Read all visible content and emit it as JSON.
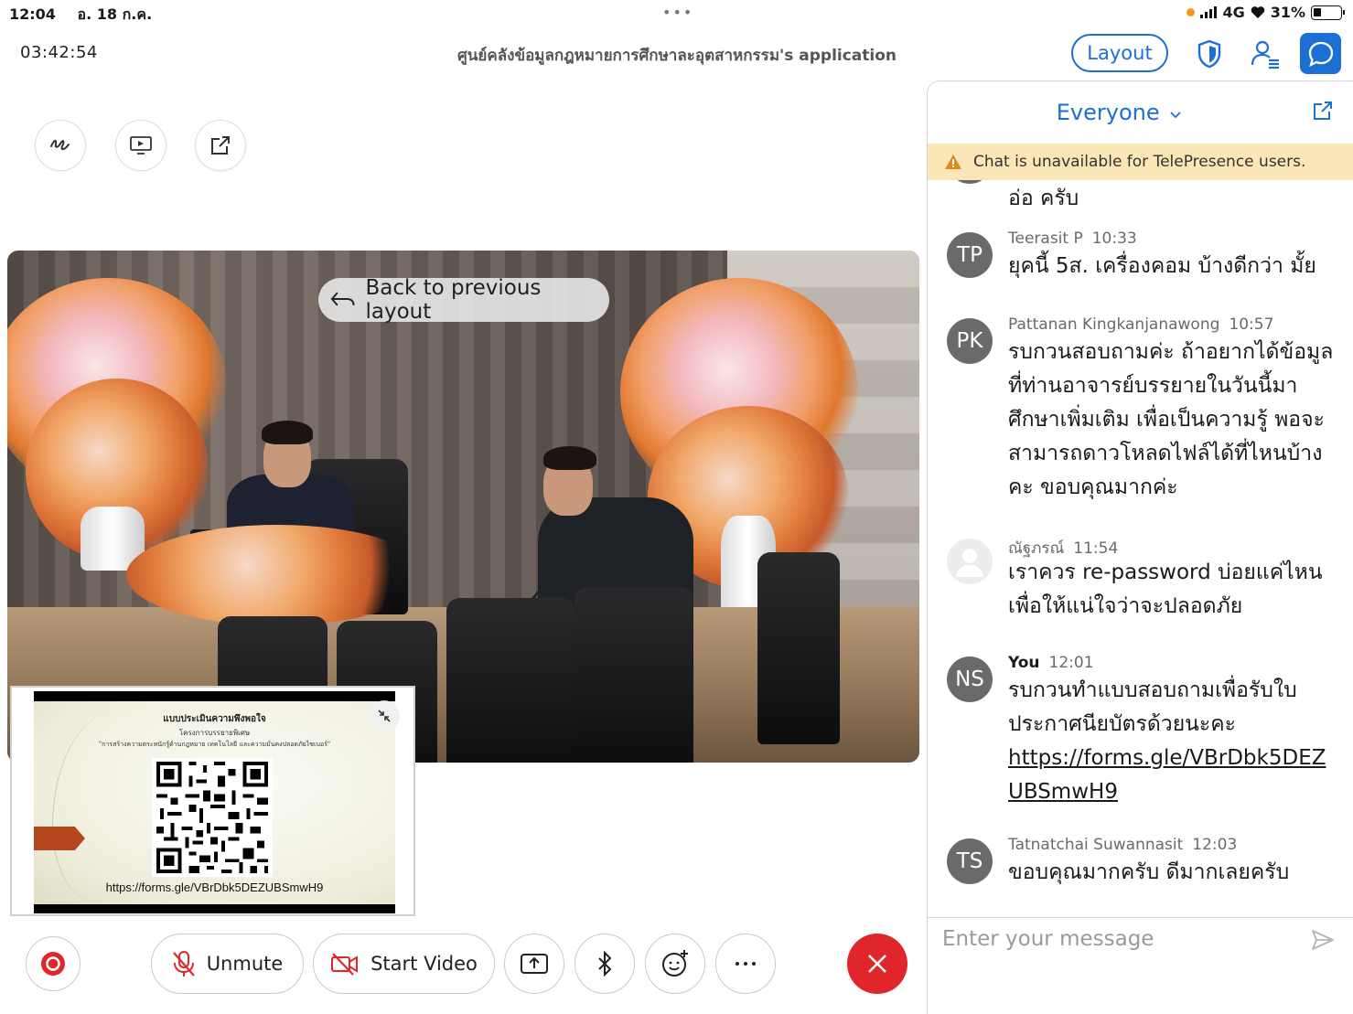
{
  "status_bar": {
    "time": "12:04",
    "date": "อ. 18 ก.ค.",
    "dots": "•••",
    "network": "4G",
    "battery": "31%"
  },
  "header": {
    "timer": "03:42:54",
    "title": "ศูนย์คลังข้อมูลกฎหมายการศึกษาละอุตสาหกรรม's application",
    "layout_label": "Layout"
  },
  "tools": {
    "annotate_icon": "annotate-icon",
    "share_screen_icon": "screen-share-icon",
    "popout_icon": "external-window-icon"
  },
  "video": {
    "back_label": "Back to previous layout"
  },
  "slide": {
    "title": "แบบประเมินความพึงพอใจ",
    "subtitle": "โครงการบรรยายพิเศษ",
    "topic": "\"การสร้างความตระหนักรู้ด้านกฎหมาย เทคโนโลยี และความมั่นคงปลอดภัยไซเบอร์\"",
    "url": "https://forms.gle/VBrDbk5DEZUBSmwH9"
  },
  "controls": {
    "unmute": "Unmute",
    "start_video": "Start Video"
  },
  "chat": {
    "audience": "Everyone",
    "warning": "Chat is unavailable for TelePresence users.",
    "partial_text": "อ่อ ครับ",
    "messages": [
      {
        "initials": "TP",
        "sender": "Teerasit P",
        "time": "10:33",
        "text": "ยุคนี้  5ส. เครื่องคอม บ้างดีกว่า มั้ย"
      },
      {
        "initials": "PK",
        "sender": "Pattanan Kingkanjanawong",
        "time": "10:57",
        "text": "รบกวนสอบถามค่ะ ถ้าอยากได้ข้อมูลที่ท่านอาจารย์บรรยายในวันนี้มาศึกษาเพิ่มเติม เพื่อเป็นความรู้ พอจะสามารถดาวโหลดไฟล์ได้ที่ไหนบ้างคะ ขอบคุณมากค่ะ"
      },
      {
        "initials": "",
        "sender": "ณัฐภรณ์",
        "time": "11:54",
        "text": "เราควร re-password บ่อยแค่ไหน เพื่อให้แน่ใจว่าจะปลอดภัย"
      },
      {
        "initials": "NS",
        "sender": "You",
        "time": "12:01",
        "text": "รบกวนทำแบบสอบถามเพื่อรับใบประกาศนียบัตรด้วยนะคะ",
        "link": "https://forms.gle/VBrDbk5DEZUBSmwH9"
      },
      {
        "initials": "TS",
        "sender": "Tatnatchai Suwannasit",
        "time": "12:03",
        "text": "ขอบคุณมากครับ ดีมากเลยครับ"
      }
    ],
    "placeholder": "Enter your message"
  },
  "colors": {
    "accent": "#1d6fd3",
    "end_call": "#e0262a",
    "warning_bg": "#fbe6b8",
    "avatar": "#6a6a6a"
  }
}
